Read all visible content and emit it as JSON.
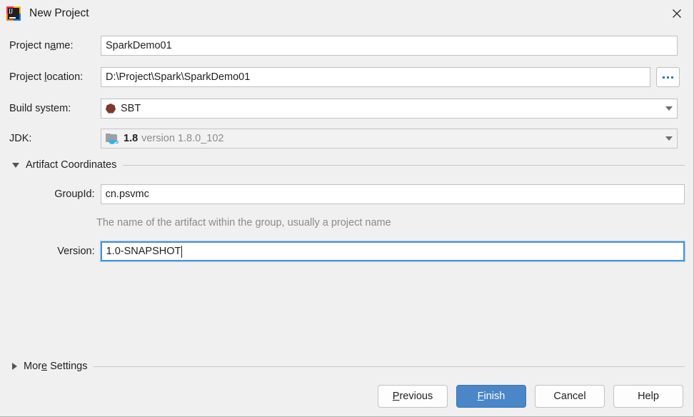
{
  "window": {
    "title": "New Project",
    "app_icon": "intellij-idea-logo",
    "close_icon": "close-icon"
  },
  "form": {
    "project_name": {
      "label_pre": "Project n",
      "label_mn": "a",
      "label_post": "me:",
      "value": "SparkDemo01"
    },
    "project_location": {
      "label_pre": "Project ",
      "label_mn": "l",
      "label_post": "ocation:",
      "value": "D:\\Project\\Spark\\SparkDemo01",
      "browse_label": "..."
    },
    "build_system": {
      "label": "Build system:",
      "value": "SBT",
      "icon": "sbt-icon"
    },
    "jdk": {
      "label": "JDK:",
      "value": "1.8",
      "version_text": "version 1.8.0_102",
      "icon": "jdk-folder-icon"
    }
  },
  "artifact_section": {
    "title": "Artifact Coordinates",
    "expanded": true,
    "group_id": {
      "label": "GroupId:",
      "value": "cn.psvmc"
    },
    "hint": "The name of the artifact within the group, usually a project name",
    "version": {
      "label": "Version:",
      "value": "1.0-SNAPSHOT",
      "focused": true
    }
  },
  "more_settings": {
    "title_pre": "Mor",
    "title_mn": "e",
    "title_post": " Settings",
    "expanded": false
  },
  "footer": {
    "previous": {
      "pre": "",
      "mn": "P",
      "post": "revious"
    },
    "finish": {
      "pre": "",
      "mn": "F",
      "post": "inish"
    },
    "cancel": {
      "label": "Cancel"
    },
    "help": {
      "label": "Help"
    }
  },
  "colors": {
    "background": "#f0f0f0",
    "primary_button": "#4a86c8",
    "focus_border": "#4a90d9",
    "sbt_brown": "#7a3b2e",
    "hint_gray": "#8a8a8a"
  }
}
